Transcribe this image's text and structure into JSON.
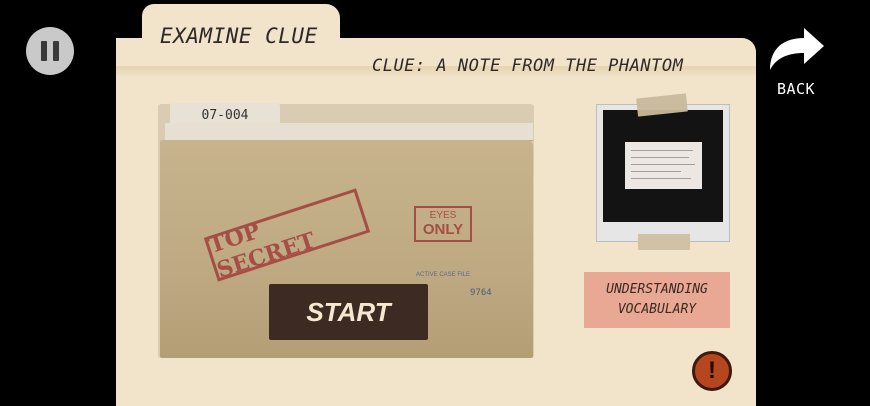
{
  "header": {
    "tab_title": "EXAMINE CLUE",
    "subtitle": "CLUE: A NOTE FROM THE PHANTOM"
  },
  "navigation": {
    "back_label": "BACK",
    "pause_icon": "pause-icon",
    "back_icon": "curved-arrow-icon"
  },
  "envelope": {
    "file_tab": "07-004",
    "stamp_top_secret": "TOP SECRET",
    "stamp_eyes_line1": "EYES",
    "stamp_eyes_line2": "ONLY",
    "file_label": "ACTIVE CASE FILE",
    "file_number": "9764"
  },
  "actions": {
    "start_label": "START",
    "vocab_line1": "UNDERSTANDING",
    "vocab_line2": "VOCABULARY",
    "alert_symbol": "!"
  },
  "colors": {
    "folder": "#f1e4cb",
    "start_button": "#3d2a22",
    "vocab_button": "#e8a893",
    "alert_button": "#b6461e",
    "stamp_red": "#a64e46"
  }
}
